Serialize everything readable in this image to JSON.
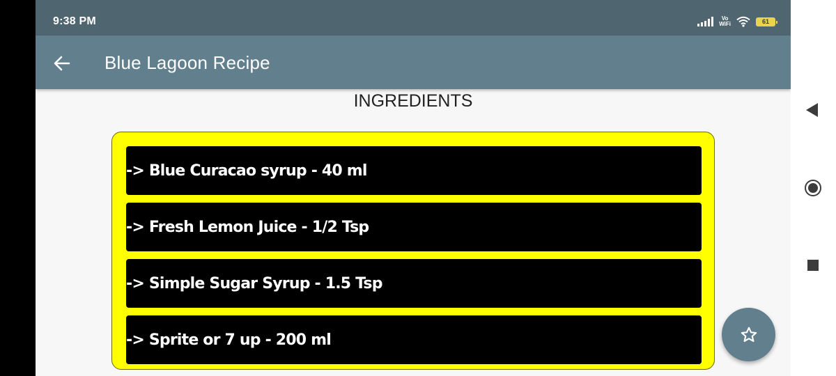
{
  "status_bar": {
    "time": "9:38 PM",
    "network_label_top": "Vo",
    "network_label_bottom": "WiFi",
    "battery_level": "61",
    "icons": [
      "signal-icon",
      "vowifi-icon",
      "wifi-icon",
      "battery-icon"
    ]
  },
  "app_bar": {
    "title": "Blue Lagoon Recipe",
    "back_icon": "arrow-left-icon"
  },
  "section": {
    "heading": "INGREDIENTS"
  },
  "ingredients": [
    "-> Blue Curacao syrup - 40 ml",
    "-> Fresh Lemon Juice - 1/2 Tsp",
    "-> Simple Sugar Syrup - 1.5 Tsp",
    "-> Sprite or 7 up - 200 ml"
  ],
  "fab": {
    "icon": "star-outline-icon"
  },
  "nav_bar": {
    "icons": [
      "nav-back-icon",
      "nav-home-icon",
      "nav-recents-icon"
    ]
  },
  "colors": {
    "status_bar": "#4f6671",
    "app_bar": "#617f8d",
    "card_background": "#ffff00",
    "ingredient_row": "#000000",
    "ingredient_text": "#ffffff",
    "fab": "#617f8d"
  }
}
